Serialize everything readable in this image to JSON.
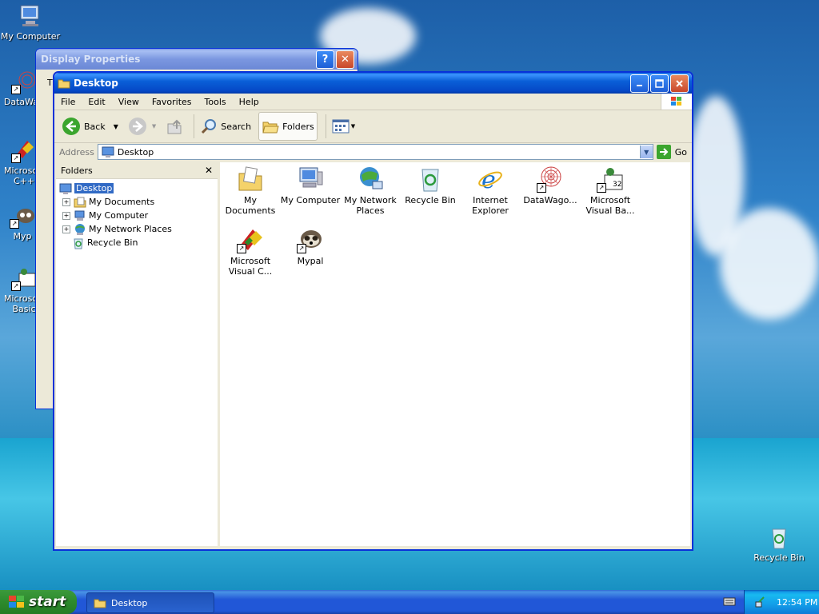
{
  "desktop": {
    "icons": [
      {
        "label": "My Computer"
      },
      {
        "label": "DataWag"
      },
      {
        "label": "Microsoft C++"
      },
      {
        "label": "Myp"
      },
      {
        "label": "Microsoft Basic"
      },
      {
        "label": "Recycle Bin"
      }
    ]
  },
  "display_properties": {
    "title": "Display Properties",
    "help_label": "?",
    "close_label": "✕",
    "tab_stub": "T"
  },
  "explorer": {
    "title": "Desktop",
    "menu": [
      "File",
      "Edit",
      "View",
      "Favorites",
      "Tools",
      "Help"
    ],
    "toolbar": {
      "back": "Back",
      "search": "Search",
      "folders": "Folders"
    },
    "address": {
      "label": "Address",
      "value": "Desktop",
      "go": "Go"
    },
    "folders_panel": {
      "title": "Folders",
      "close": "✕",
      "tree": [
        {
          "label": "Desktop",
          "selected": true,
          "expander": ""
        },
        {
          "label": "My Documents",
          "expander": "+"
        },
        {
          "label": "My Computer",
          "expander": "+"
        },
        {
          "label": "My Network Places",
          "expander": "+"
        },
        {
          "label": "Recycle Bin",
          "expander": ""
        }
      ]
    },
    "items": [
      {
        "line1": "My Documents",
        "line2": ""
      },
      {
        "line1": "My Computer",
        "line2": ""
      },
      {
        "line1": "My Network",
        "line2": "Places"
      },
      {
        "line1": "Recycle Bin",
        "line2": ""
      },
      {
        "line1": "Internet",
        "line2": "Explorer"
      },
      {
        "line1": "DataWago...",
        "line2": ""
      },
      {
        "line1": "Microsoft",
        "line2": "Visual Ba..."
      },
      {
        "line1": "Microsoft",
        "line2": "Visual C..."
      },
      {
        "line1": "Mypal",
        "line2": ""
      }
    ]
  },
  "taskbar": {
    "start": "start",
    "task": "Desktop",
    "clock": "12:54 PM"
  },
  "colors": {
    "xp_blue": "#0a5fd8",
    "start_green": "#2d8a2d",
    "selection": "#316ac5"
  }
}
